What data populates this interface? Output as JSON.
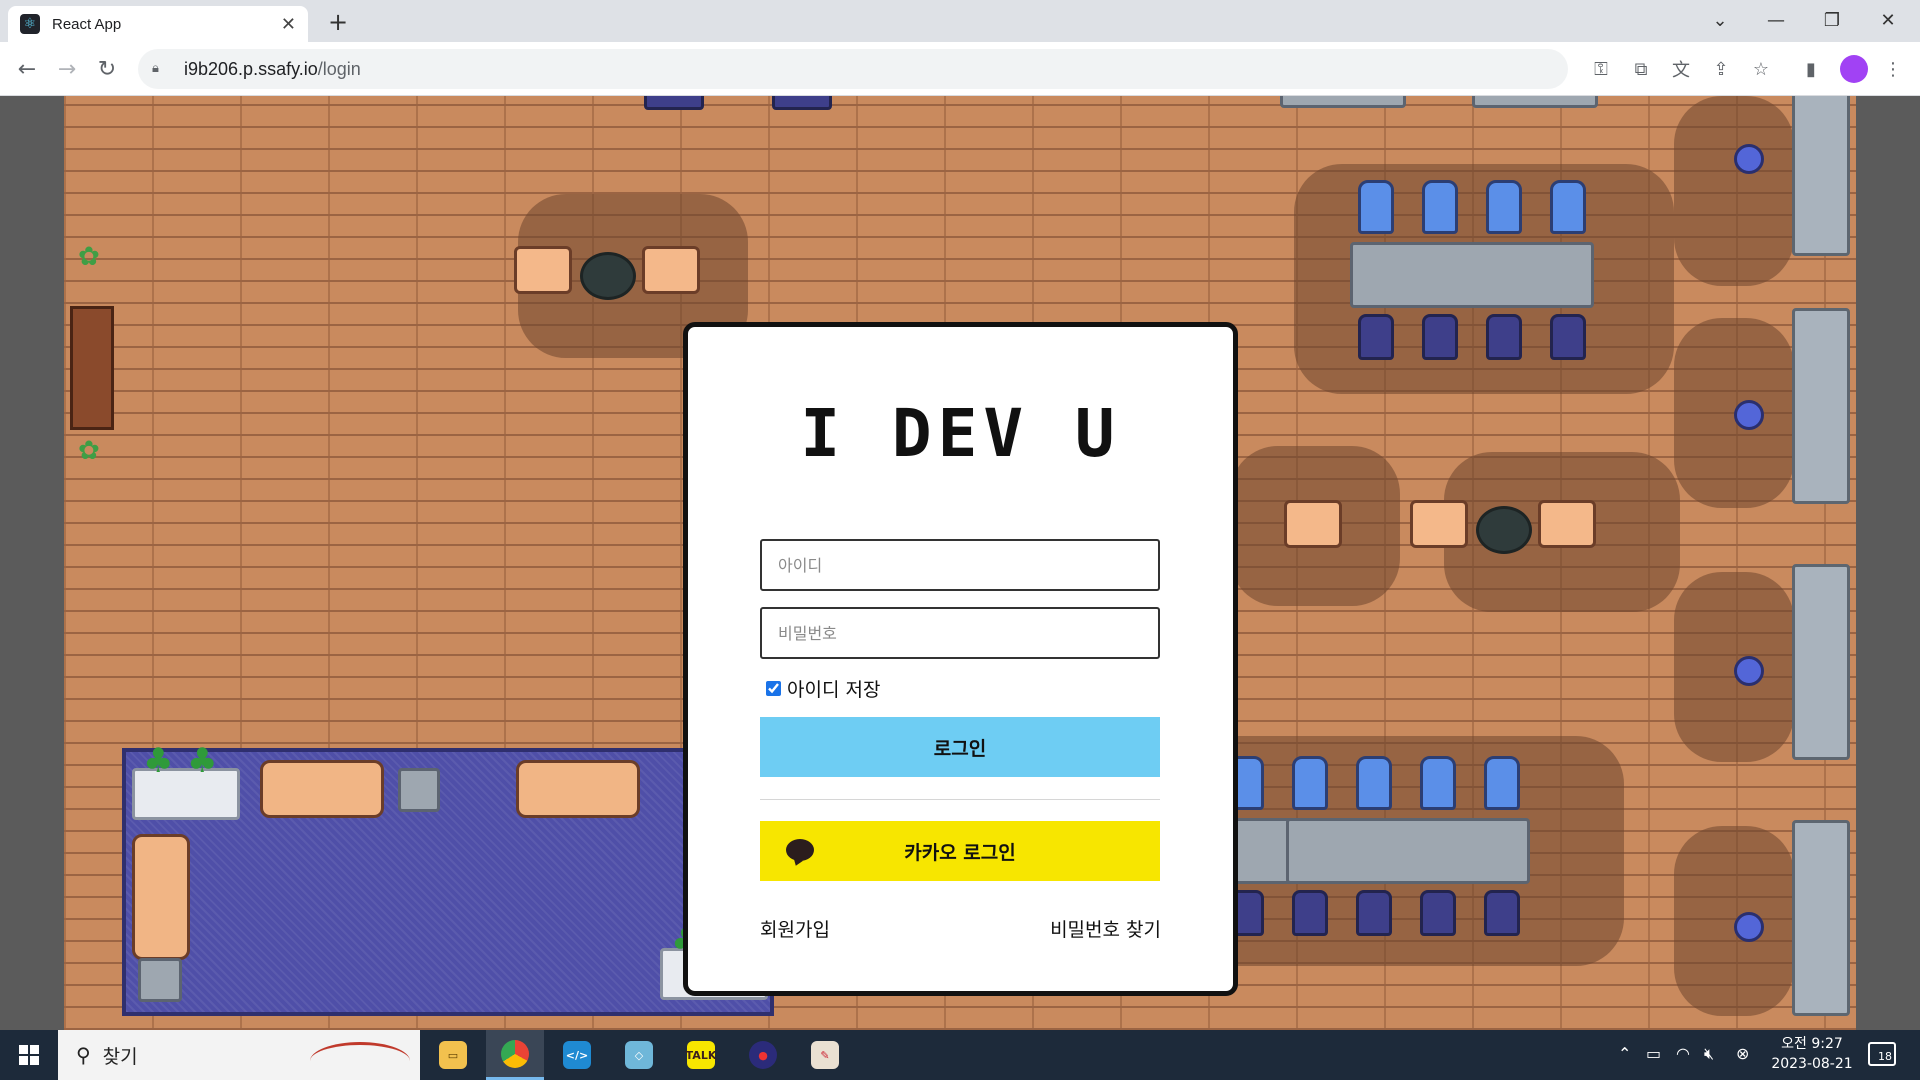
{
  "browser": {
    "tab_title": "React App",
    "url_host": "i9b206.p.ssafy.io",
    "url_path": "/login"
  },
  "login": {
    "logo": "I DEV U",
    "id_placeholder": "아이디",
    "password_placeholder": "비밀번호",
    "save_id_label": "아이디 저장",
    "save_id_checked": true,
    "login_button": "로그인",
    "kakao_button": "카카오 로그인",
    "signup_link": "회원가입",
    "find_password_link": "비밀번호 찾기"
  },
  "taskbar": {
    "search_text": "찾기",
    "clock_time": "오전 9:27",
    "clock_date": "2023-08-21",
    "notification_count": "18"
  },
  "colors": {
    "login_button": "#6ecdf3",
    "kakao_button": "#f7e600",
    "floor": "#c98a5e",
    "rug": "#4f4fa8"
  },
  "icons": [
    "react-icon",
    "close-icon",
    "plus-icon",
    "back-icon",
    "forward-icon",
    "reload-icon",
    "lock-icon",
    "key-icon",
    "open-external-icon",
    "translate-icon",
    "share-icon",
    "star-icon",
    "sidepanel-icon",
    "menu-icon",
    "windows-icon",
    "search-icon",
    "kakao-chat-icon"
  ]
}
